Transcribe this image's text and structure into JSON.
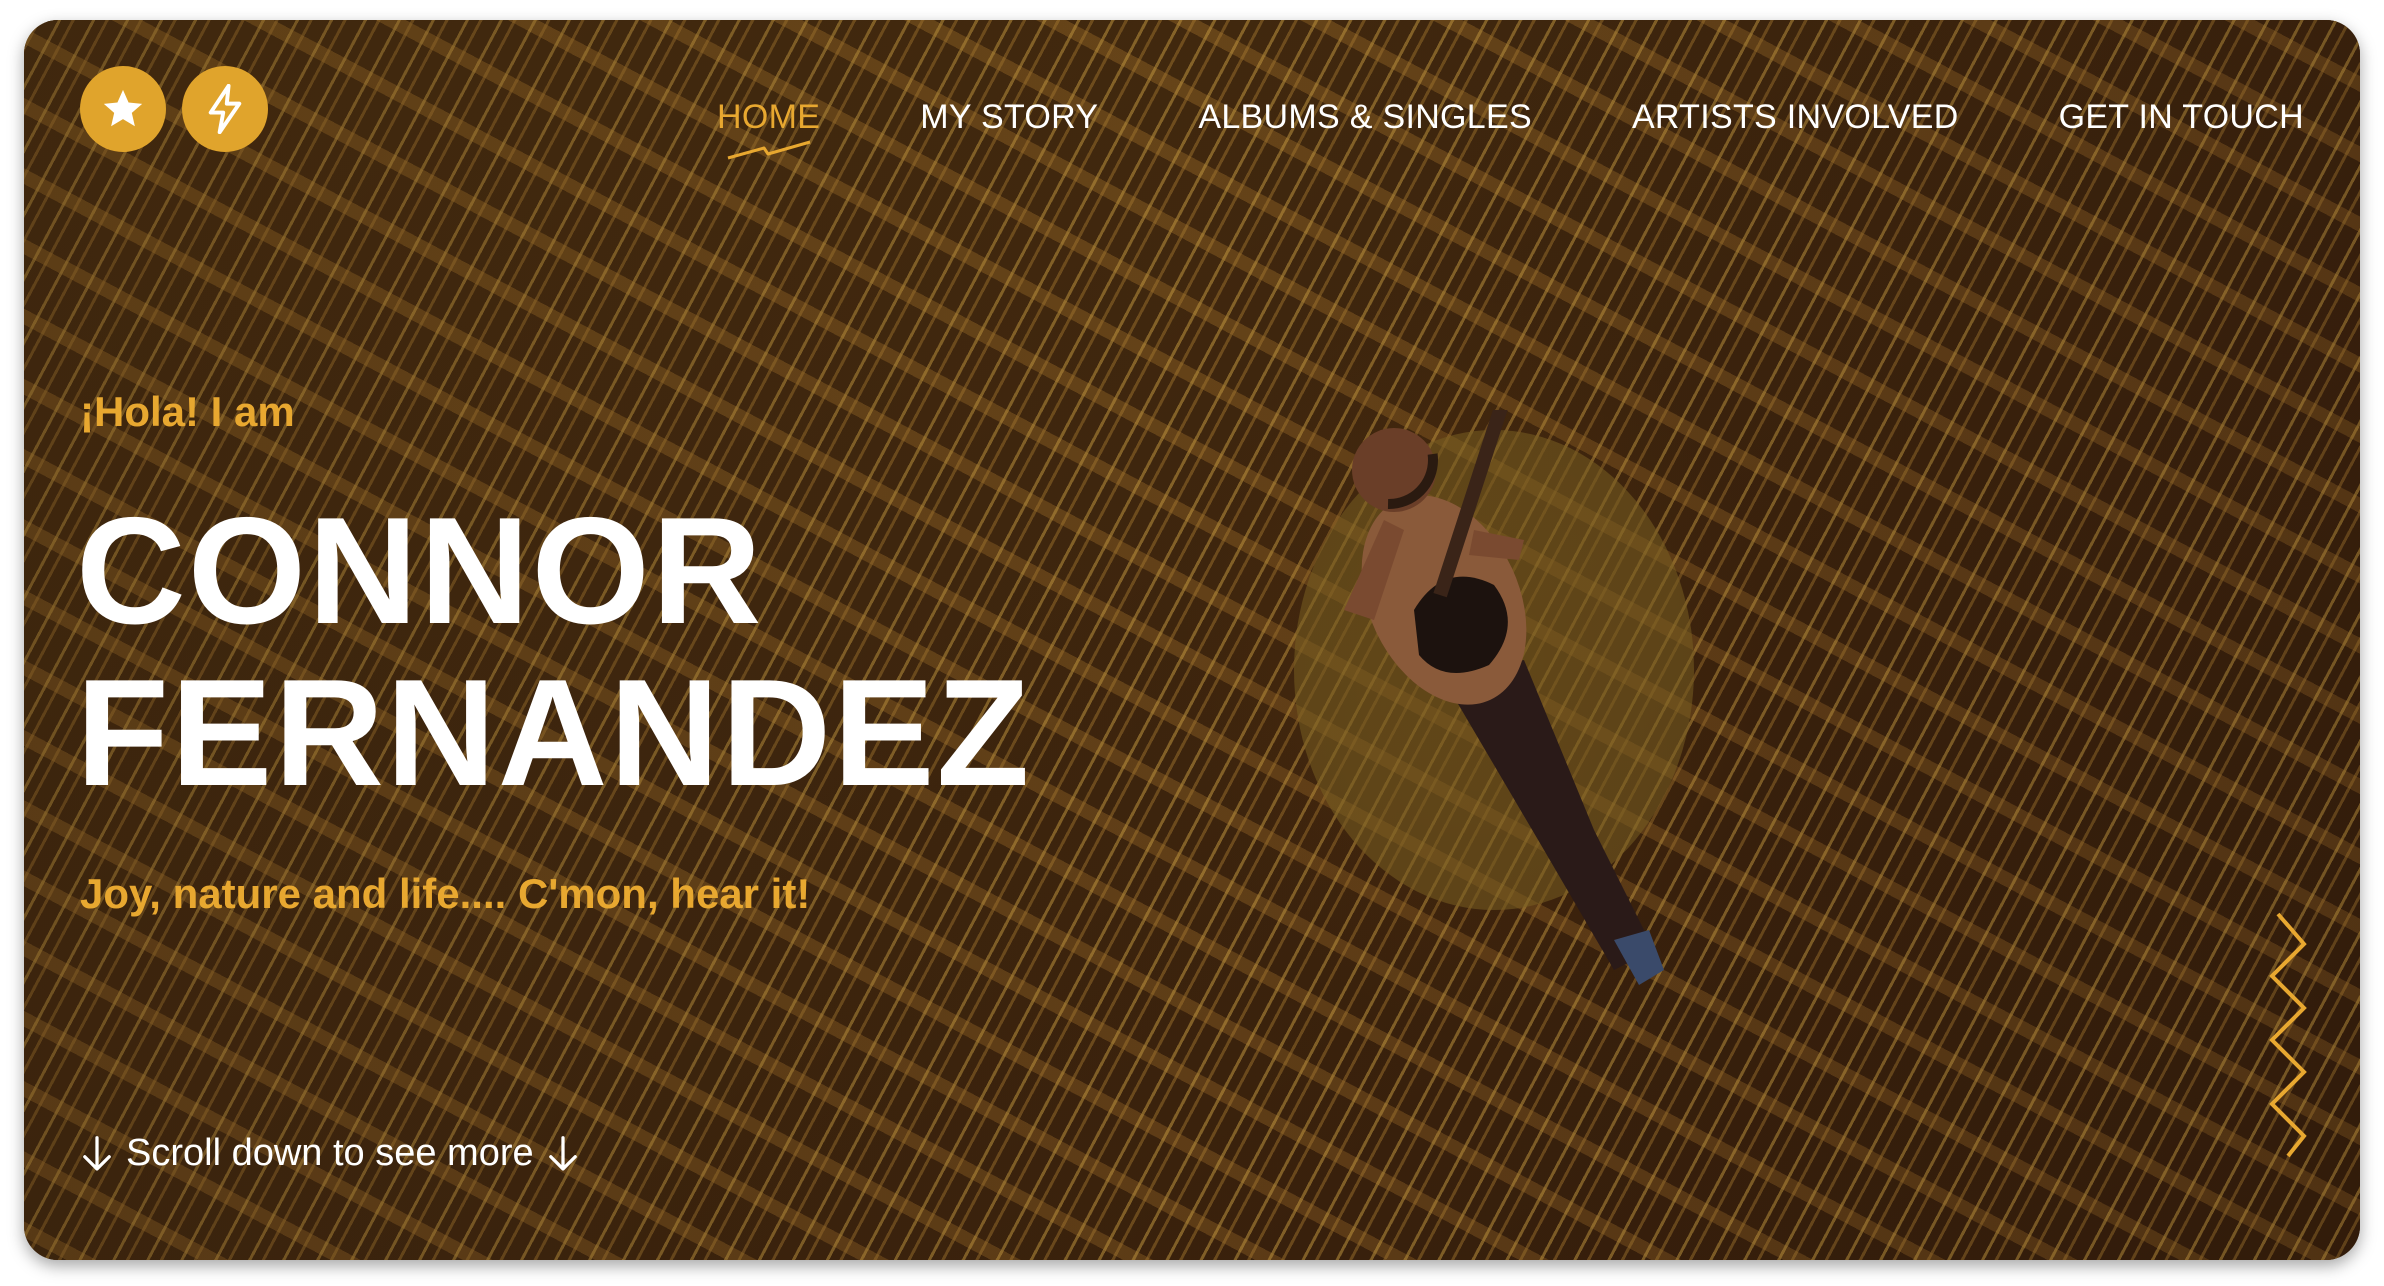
{
  "logo": {
    "icons": [
      "star-icon",
      "lightning-icon"
    ],
    "color": "#e0a42c"
  },
  "nav": {
    "items": [
      {
        "label": "HOME",
        "active": true
      },
      {
        "label": "MY STORY",
        "active": false
      },
      {
        "label": "ALBUMS & SINGLES",
        "active": false
      },
      {
        "label": "ARTISTS INVOLVED",
        "active": false
      },
      {
        "label": "GET IN TOUCH",
        "active": false
      }
    ]
  },
  "hero": {
    "greeting": "¡Hola! I am",
    "name_line1": "CONNOR",
    "name_line2": "FERNANDEZ",
    "tagline": "Joy, nature and life.... C'mon, hear it!",
    "scroll_text": "Scroll down to see more",
    "scroll_icons": [
      "arrow-down-icon",
      "arrow-down-icon"
    ]
  },
  "colors": {
    "accent": "#e8a830",
    "text": "#ffffff"
  }
}
